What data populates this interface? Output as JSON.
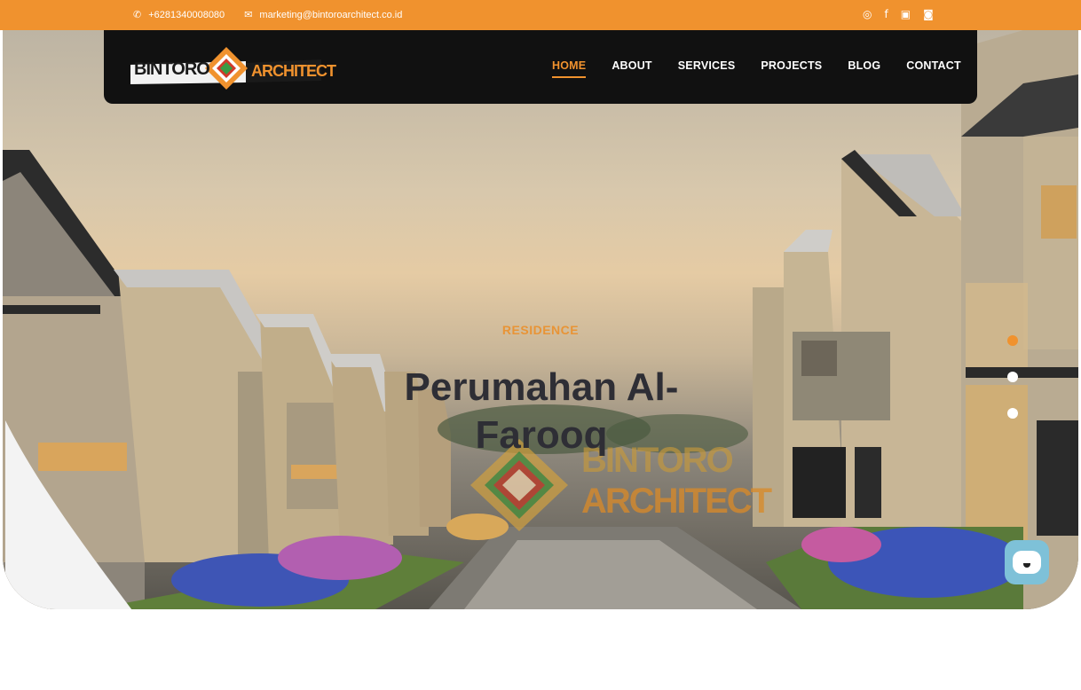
{
  "topbar": {
    "phone": "+6281340008080",
    "email": "marketing@bintoroarchitect.co.id",
    "phone_icon": "phone-icon",
    "email_icon": "envelope-icon",
    "social": [
      "whatsapp-icon",
      "facebook-icon",
      "youtube-icon",
      "instagram-icon"
    ],
    "background": "#f0922e"
  },
  "logo": {
    "word_left": "BINTORO",
    "word_right": "ARCHITECT"
  },
  "nav": {
    "items": [
      {
        "label": "HOME",
        "active": true
      },
      {
        "label": "ABOUT",
        "active": false
      },
      {
        "label": "SERVICES",
        "active": false
      },
      {
        "label": "PROJECTS",
        "active": false
      },
      {
        "label": "BLOG",
        "active": false
      },
      {
        "label": "CONTACT",
        "active": false
      }
    ],
    "accent": "#f0922e"
  },
  "slide": {
    "tag": "RESIDENCE",
    "title": "Perumahan Al-Farooq",
    "watermark_line1": "BINTORO",
    "watermark_line2": "ARCHITECT",
    "current": 1,
    "total": 3
  },
  "chat": {
    "icon": "chat-bubble-icon"
  }
}
